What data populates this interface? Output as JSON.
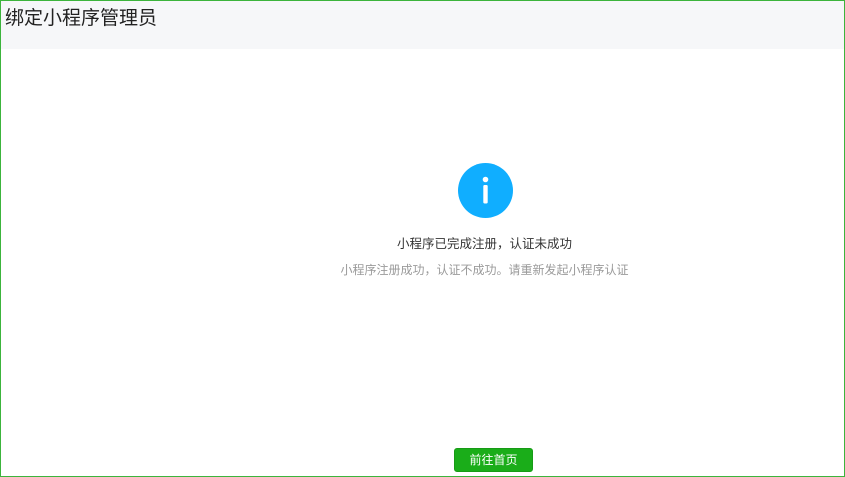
{
  "header": {
    "title": "绑定小程序管理员"
  },
  "status": {
    "icon": "info-icon",
    "icon_color": "#10aeff",
    "title": "小程序已完成注册，认证未成功",
    "description": "小程序注册成功，认证不成功。请重新发起小程序认证"
  },
  "actions": {
    "home_label": "前往首页",
    "home_color": "#1aad19"
  },
  "frame": {
    "border_color": "#3cb43c"
  }
}
